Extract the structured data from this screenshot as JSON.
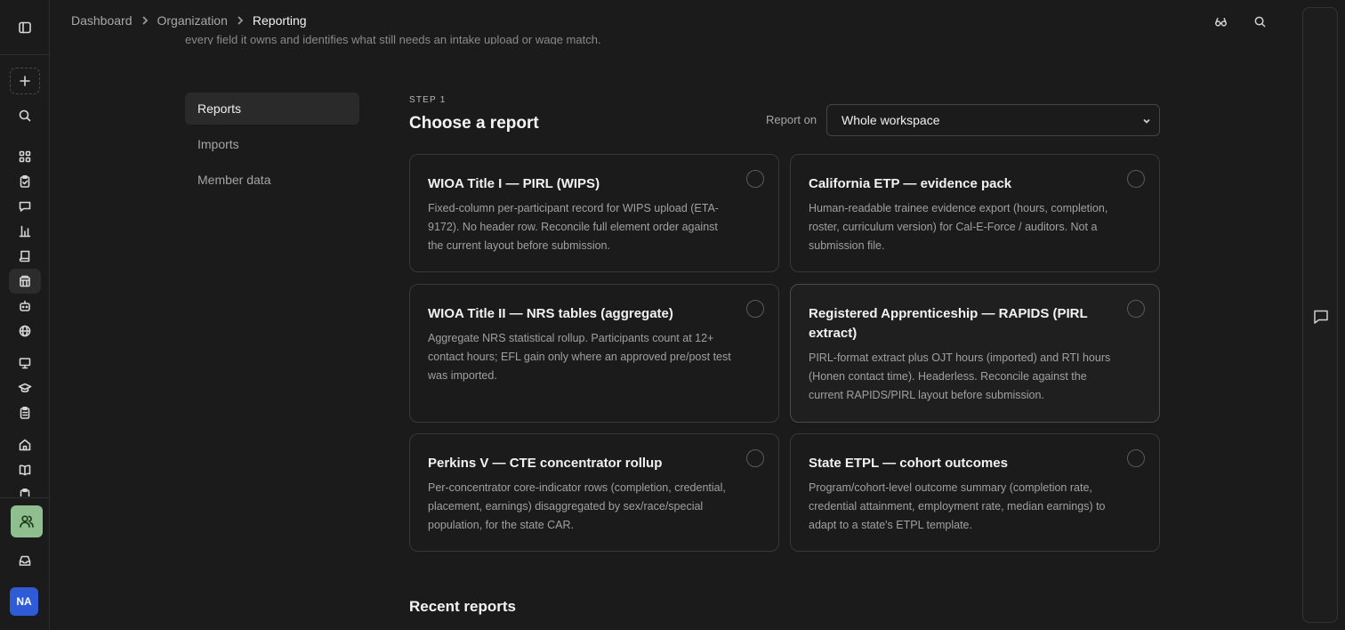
{
  "breadcrumb": {
    "items": [
      "Dashboard",
      "Organization"
    ],
    "current": "Reporting"
  },
  "intro_text": "every field it owns and identifies what still needs an intake upload or wage match.",
  "section_nav": [
    {
      "label": "Reports",
      "active": true
    },
    {
      "label": "Imports",
      "active": false
    },
    {
      "label": "Member data",
      "active": false
    }
  ],
  "step": {
    "label": "STEP 1",
    "title": "Choose a report",
    "report_on_label": "Report on",
    "report_on_value": "Whole workspace"
  },
  "reports": [
    {
      "title": "WIOA Title I — PIRL (WIPS)",
      "description": "Fixed-column per-participant record for WIPS upload (ETA-9172). No header row. Reconcile full element order against the current layout before submission."
    },
    {
      "title": "California ETP — evidence pack",
      "description": "Human-readable trainee evidence export (hours, completion, roster, curriculum version) for Cal-E-Force / auditors. Not a submission file."
    },
    {
      "title": "WIOA Title II — NRS tables (aggregate)",
      "description": "Aggregate NRS statistical rollup. Participants count at 12+ contact hours; EFL gain only where an approved pre/post test was imported."
    },
    {
      "title": "Registered Apprenticeship — RAPIDS (PIRL extract)",
      "description": "PIRL-format extract plus OJT hours (imported) and RTI hours (Honen contact time). Headerless. Reconcile against the current RAPIDS/PIRL layout before submission."
    },
    {
      "title": "Perkins V — CTE concentrator rollup",
      "description": "Per-concentrator core-indicator rows (completion, credential, placement, earnings) disaggregated by sex/race/special population, for the state CAR."
    },
    {
      "title": "State ETPL — cohort outcomes",
      "description": "Program/cohort-level outcome summary (completion rate, credential attainment, employment rate, median earnings) to adapt to a state's ETPL template."
    }
  ],
  "recent_reports_title": "Recent reports",
  "user": {
    "initials": "NA"
  },
  "colors": {
    "background": "#1b1b1b",
    "accent_people": "#8fbf8f",
    "avatar": "#2f5bd6"
  }
}
